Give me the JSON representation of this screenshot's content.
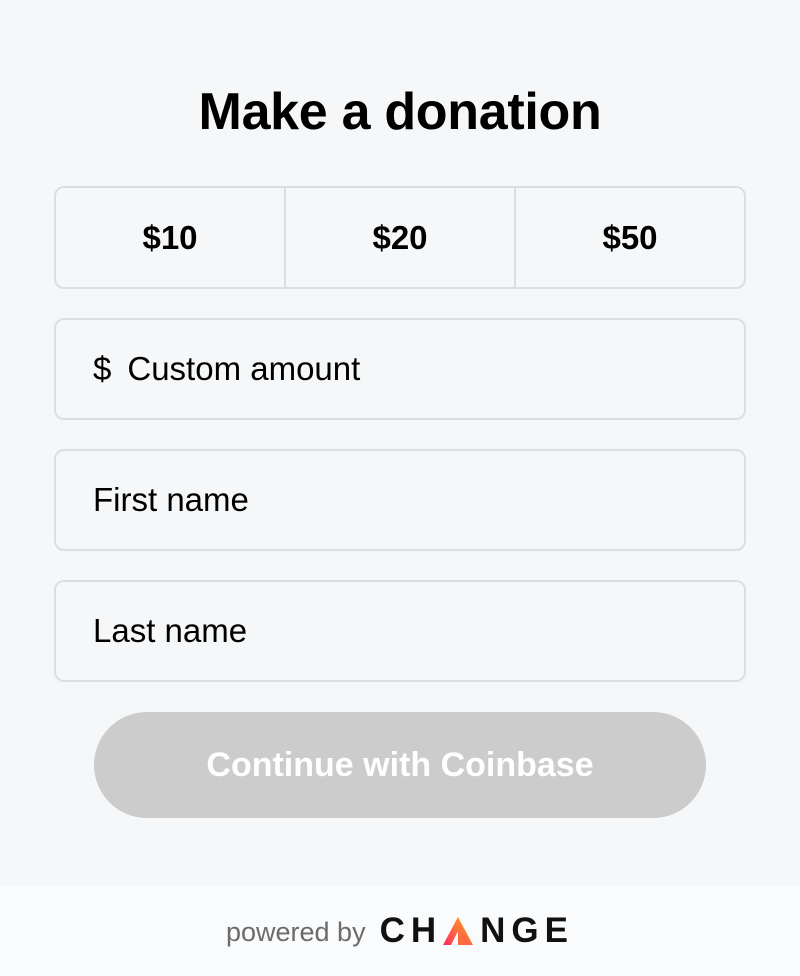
{
  "title": "Make a donation",
  "amounts": [
    "$10",
    "$20",
    "$50"
  ],
  "custom_amount": {
    "currency": "$",
    "placeholder": "Custom amount"
  },
  "first_name": {
    "placeholder": "First name"
  },
  "last_name": {
    "placeholder": "Last name"
  },
  "cta": {
    "label": "Continue with Coinbase",
    "state": "disabled"
  },
  "footer": {
    "powered_by": "powered by",
    "brand_before": "CH",
    "brand_after": "NGE"
  },
  "colors": {
    "background": "#f5f7f8",
    "border": "#dcdfe2",
    "button_disabled": "#cccccc",
    "brand_gradient_start": "#ff2a5e",
    "brand_gradient_end": "#ffb21a"
  }
}
